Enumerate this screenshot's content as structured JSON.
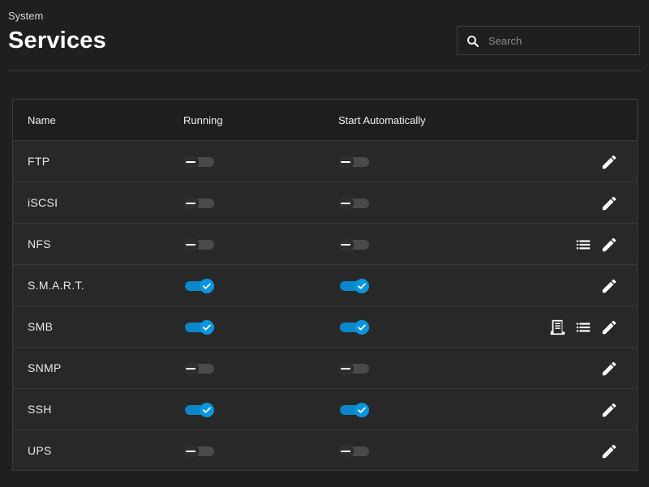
{
  "header": {
    "breadcrumb": "System",
    "title": "Services"
  },
  "search": {
    "placeholder": "Search",
    "icon": "search-icon"
  },
  "table": {
    "columns": [
      "Name",
      "Running",
      "Start Automatically"
    ],
    "rows": [
      {
        "name": "FTP",
        "running": false,
        "start_automatically": false,
        "actions": [
          "edit"
        ]
      },
      {
        "name": "iSCSI",
        "running": false,
        "start_automatically": false,
        "actions": [
          "edit"
        ]
      },
      {
        "name": "NFS",
        "running": false,
        "start_automatically": false,
        "actions": [
          "list",
          "edit"
        ]
      },
      {
        "name": "S.M.A.R.T.",
        "running": true,
        "start_automatically": true,
        "actions": [
          "edit"
        ]
      },
      {
        "name": "SMB",
        "running": true,
        "start_automatically": true,
        "actions": [
          "logs",
          "list",
          "edit"
        ]
      },
      {
        "name": "SNMP",
        "running": false,
        "start_automatically": false,
        "actions": [
          "edit"
        ]
      },
      {
        "name": "SSH",
        "running": true,
        "start_automatically": true,
        "actions": [
          "edit"
        ]
      },
      {
        "name": "UPS",
        "running": false,
        "start_automatically": false,
        "actions": [
          "edit"
        ]
      }
    ]
  },
  "colors": {
    "background": "#1f1f1f",
    "card": "#282828",
    "accent": "#0a95dc",
    "toggle_off_track": "#4a4a4a"
  }
}
